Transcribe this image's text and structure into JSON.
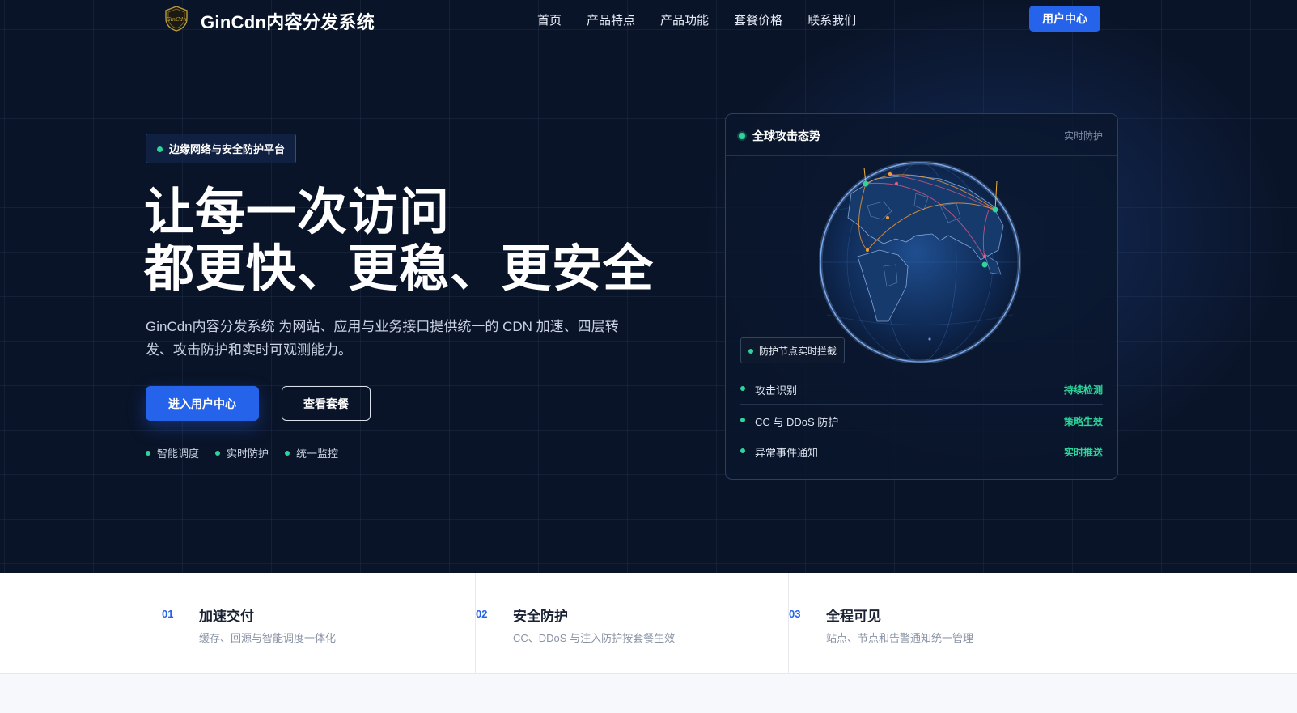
{
  "brand": {
    "name": "GinCdn内容分发系统",
    "logo_mark_text": "GinCdn"
  },
  "nav": {
    "links": [
      "首页",
      "产品特点",
      "产品功能",
      "套餐价格",
      "联系我们"
    ],
    "cta": "用户中心"
  },
  "hero": {
    "badge": "边缘网络与安全防护平台",
    "headline_line1": "让每一次访问",
    "headline_line2": "都更快、更稳、更安全",
    "subtext": "GinCdn内容分发系统 为网站、应用与业务接口提供统一的 CDN 加速、四层转发、攻击防护和实时可观测能力。",
    "primary_button": "进入用户中心",
    "secondary_button": "查看套餐",
    "tags": [
      "智能调度",
      "实时防护",
      "统一监控"
    ]
  },
  "panel": {
    "title": "全球攻击态势",
    "meta": "实时防护",
    "globe_chip": "防护节点实时拦截",
    "rows": [
      {
        "label": "攻击识别",
        "status": "持续检测"
      },
      {
        "label": "CC 与 DDoS 防护",
        "status": "策略生效"
      },
      {
        "label": "异常事件通知",
        "status": "实时推送"
      }
    ]
  },
  "features": [
    {
      "num": "01",
      "title": "加速交付",
      "desc": "缓存、回源与智能调度一体化"
    },
    {
      "num": "02",
      "title": "安全防护",
      "desc": "CC、DDoS 与注入防护按套餐生效"
    },
    {
      "num": "03",
      "title": "全程可见",
      "desc": "站点、节点和告警通知统一管理"
    }
  ],
  "colors": {
    "accent": "#2563eb",
    "status_green": "#2dd49b",
    "hero_bg": "#0a1428"
  }
}
